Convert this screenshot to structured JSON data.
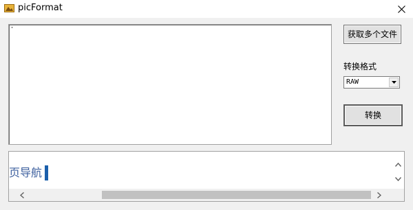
{
  "window": {
    "title": "picFormat",
    "icon": "folder-image-icon",
    "close_icon": "close-icon"
  },
  "buttons": {
    "get_files": "获取多个文件",
    "convert": "转换"
  },
  "format": {
    "label": "转换格式",
    "selected": "RAW"
  },
  "log": {
    "text": "页导航"
  },
  "colors": {
    "log_text": "#3c5f9e",
    "cursor": "#1b5fab"
  }
}
